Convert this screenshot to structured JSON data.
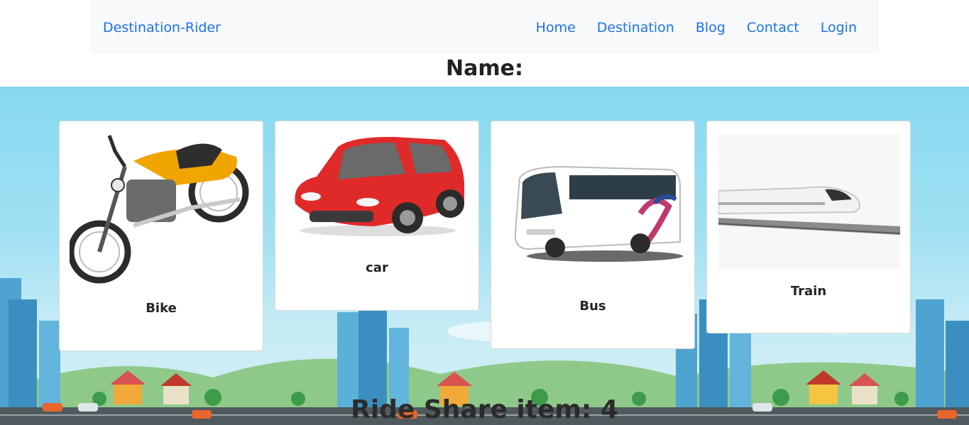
{
  "navbar": {
    "brand": "Destination-Rider",
    "links": [
      "Home",
      "Destination",
      "Blog",
      "Contact",
      "Login"
    ]
  },
  "heading": "Name:",
  "cards": [
    {
      "label": "Bike"
    },
    {
      "label": "car"
    },
    {
      "label": "Bus"
    },
    {
      "label": "Train"
    }
  ],
  "footer": {
    "text": "Ride Share item: 4"
  },
  "colors": {
    "link": "#1a73e8",
    "sky": "#86d9f2",
    "navbar_bg": "#f8f9fa"
  }
}
